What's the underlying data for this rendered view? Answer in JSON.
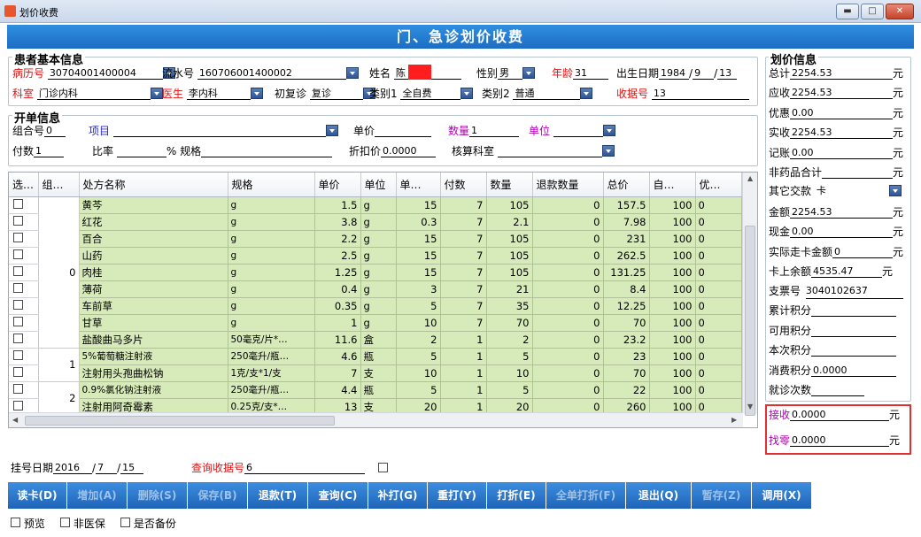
{
  "window": {
    "title": "划价收费"
  },
  "banner": "门、急诊划价收费",
  "patient": {
    "legend": "患者基本信息",
    "bingli_label": "病历号",
    "bingli_value": "30704001400004",
    "liushui_label": "流水号",
    "liushui_value": "160706001400002",
    "name_label": "姓名",
    "name_value": "陈",
    "sex_label": "性别",
    "sex_value": "男",
    "age_label": "年龄",
    "age_value": "31",
    "birth_label": "出生日期",
    "birth_y": "1984",
    "birth_m": "9",
    "birth_d": "13",
    "dept_label": "科室",
    "dept_value": "门诊内科",
    "doctor_label": "医生",
    "doctor_value": "李内科",
    "visit_label": "初复诊",
    "visit_value": "复诊",
    "type1_label": "类别1",
    "type1_value": "全自费",
    "type2_label": "类别2",
    "type2_value": "普通",
    "receipt_label": "收据号",
    "receipt_value": "13"
  },
  "order": {
    "legend": "开单信息",
    "group_label": "组合号",
    "group_value": "0",
    "item_label": "项目",
    "price_label": "单价",
    "qty_label": "数量",
    "qty_value": "1",
    "unit_label": "单位",
    "count_label": "付数",
    "count_value": "1",
    "ratio_label": "比率",
    "pct": "%",
    "spec_label": "规格",
    "discount_label": "折扣价",
    "discount_value": "0.0000",
    "acct_label": "核算科室"
  },
  "table": {
    "headers": [
      "选…",
      "组…",
      "处方名称",
      "规格",
      "单价",
      "单位",
      "单…",
      "付数",
      "数量",
      "退款数量",
      "总价",
      "自…",
      "优…"
    ],
    "rows": [
      [
        "黄芩",
        "g",
        "1.5",
        "g",
        "15",
        "7",
        "105",
        "0",
        "157.5",
        "100"
      ],
      [
        "红花",
        "g",
        "3.8",
        "g",
        "0.3",
        "7",
        "2.1",
        "0",
        "7.98",
        "100"
      ],
      [
        "百合",
        "g",
        "2.2",
        "g",
        "15",
        "7",
        "105",
        "0",
        "231",
        "100"
      ],
      [
        "山药",
        "g",
        "2.5",
        "g",
        "15",
        "7",
        "105",
        "0",
        "262.5",
        "100"
      ],
      [
        "肉桂",
        "g",
        "1.25",
        "g",
        "15",
        "7",
        "105",
        "0",
        "131.25",
        "100"
      ],
      [
        "薄荷",
        "g",
        "0.4",
        "g",
        "3",
        "7",
        "21",
        "0",
        "8.4",
        "100"
      ],
      [
        "车前草",
        "g",
        "0.35",
        "g",
        "5",
        "7",
        "35",
        "0",
        "12.25",
        "100"
      ],
      [
        "甘草",
        "g",
        "1",
        "g",
        "10",
        "7",
        "70",
        "0",
        "70",
        "100"
      ],
      [
        "盐酸曲马多片",
        "50毫克/片*…",
        "11.6",
        "盒",
        "2",
        "1",
        "2",
        "0",
        "23.2",
        "100"
      ],
      [
        "5%葡萄糖注射液",
        "250毫升/瓶…",
        "4.6",
        "瓶",
        "5",
        "1",
        "5",
        "0",
        "23",
        "100"
      ],
      [
        "注射用头孢曲松钠",
        "1克/支*1/支",
        "7",
        "支",
        "10",
        "1",
        "10",
        "0",
        "70",
        "100"
      ],
      [
        "0.9%氯化钠注射液",
        "250毫升/瓶…",
        "4.4",
        "瓶",
        "5",
        "1",
        "5",
        "0",
        "22",
        "100"
      ],
      [
        "注射用阿奇霉素",
        "0.25克/支*…",
        "13",
        "支",
        "20",
        "1",
        "20",
        "0",
        "260",
        "100"
      ]
    ],
    "groups": [
      "0",
      "1",
      "2"
    ],
    "last_col": "0"
  },
  "reg": {
    "date_label": "挂号日期",
    "y": "2016",
    "m": "7",
    "d": "15",
    "query_label": "查询收据号",
    "query_value": "6"
  },
  "buttons": [
    "读卡(D)",
    "增加(A)",
    "删除(S)",
    "保存(B)",
    "退款(T)",
    "查询(C)",
    "补打(G)",
    "重打(Y)",
    "打折(E)",
    "全单打折(F)",
    "退出(Q)",
    "暂存(Z)",
    "调用(X)"
  ],
  "checks": [
    "预览",
    "非医保",
    "是否备份"
  ],
  "pricing": {
    "legend": "划价信息",
    "total_label": "总计",
    "total": "2254.53",
    "due_label": "应收",
    "due": "2254.53",
    "disc_label": "优惠",
    "disc": "0.00",
    "paid_label": "实收",
    "paid": "2254.53",
    "credit_label": "记账",
    "credit": "0.00",
    "nondrug_label": "非药品合计",
    "other_label": "其它交款",
    "other_value": "卡",
    "amount_label": "金额",
    "amount": "2254.53",
    "cash_label": "现金",
    "cash": "0.00",
    "card_label": "实际走卡金额",
    "card": "0",
    "balance_label": "卡上余额",
    "balance": "4535.47",
    "cheque_label": "支票号",
    "cheque": "3040102637",
    "cum_label": "累计积分",
    "avail_label": "可用积分",
    "this_label": "本次积分",
    "consume_label": "消费积分",
    "consume": "0.0000",
    "visits_label": "就诊次数",
    "receive_label": "接收",
    "receive": "0.0000",
    "change_label": "找零",
    "change": "0.0000",
    "unit": "元"
  }
}
